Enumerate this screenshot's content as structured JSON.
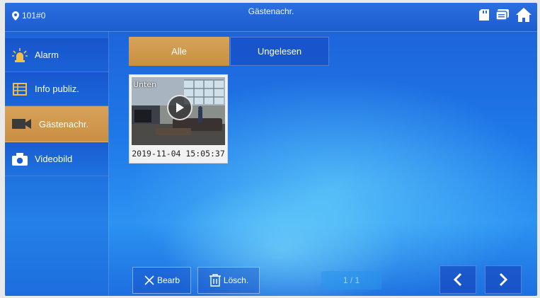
{
  "header": {
    "room": "101#0",
    "title": "Gästenachr."
  },
  "sidebar": {
    "items": [
      {
        "label": "Alarm",
        "icon": "alarm-icon"
      },
      {
        "label": "Info publiz.",
        "icon": "info-board-icon"
      },
      {
        "label": "Gästenachr.",
        "icon": "video-camera-icon",
        "active": true
      },
      {
        "label": "Videobild",
        "icon": "camera-icon"
      }
    ]
  },
  "tabs": [
    {
      "label": "Alle",
      "active": true
    },
    {
      "label": "Ungelesen",
      "active": false
    }
  ],
  "messages": [
    {
      "thumb_label": "Unten",
      "timestamp": "2019-11-04 15:05:37"
    }
  ],
  "footer": {
    "edit_label": "Bearb",
    "delete_label": "Lösch.",
    "page": "1 / 1"
  },
  "colors": {
    "accent": "#d09a50",
    "background": "#1f78e8"
  }
}
